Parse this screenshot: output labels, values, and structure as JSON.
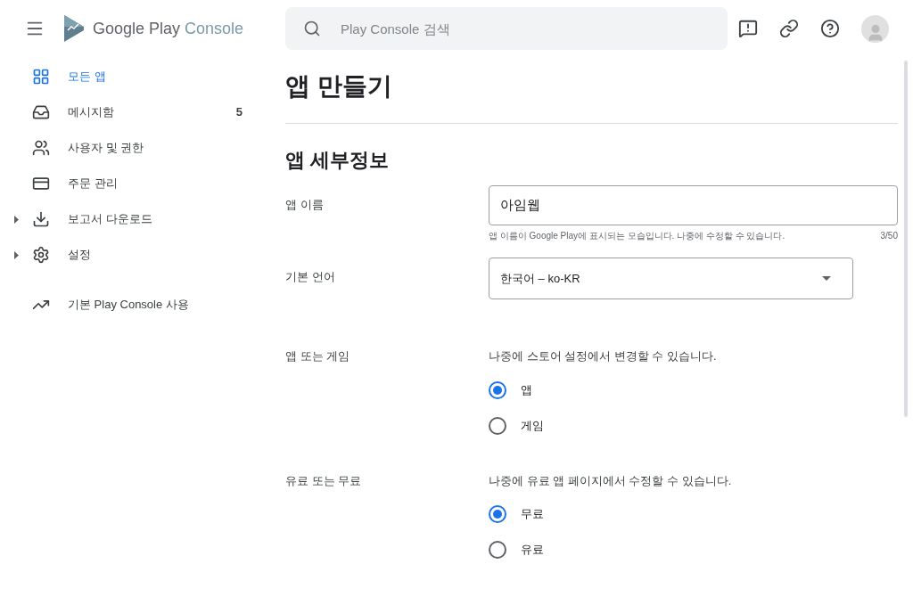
{
  "header": {
    "brand_main": "Google Play",
    "brand_sub": "Console",
    "search": {
      "placeholder": "Play Console 검색"
    }
  },
  "sidebar": {
    "items": [
      {
        "kind": "apps",
        "label": "모든 앱",
        "selected": true,
        "expandable": false
      },
      {
        "kind": "inbox",
        "label": "메시지함",
        "badge": "5",
        "selected": false,
        "expandable": false
      },
      {
        "kind": "users",
        "label": "사용자 및 권한",
        "selected": false,
        "expandable": false
      },
      {
        "kind": "card",
        "label": "주문 관리",
        "selected": false,
        "expandable": false
      },
      {
        "kind": "download",
        "label": "보고서 다운로드",
        "selected": false,
        "expandable": true
      },
      {
        "kind": "settings",
        "label": "설정",
        "selected": false,
        "expandable": true
      }
    ],
    "footer_item": {
      "kind": "trend",
      "label": "기본 Play Console 사용"
    }
  },
  "page": {
    "title": "앱 만들기",
    "section_title": "앱 세부정보",
    "app_name": {
      "label": "앱 이름",
      "value": "아임웹",
      "helper": "앱 이름이 Google Play에 표시되는 모습입니다. 나중에 수정할 수 있습니다.",
      "counter": "3/50"
    },
    "language": {
      "label": "기본 언어",
      "value": "한국어 – ko-KR"
    },
    "radio_groups": [
      {
        "label": "앱 또는 게임",
        "description": "나중에 스토어 설정에서 변경할 수 있습니다.",
        "options": [
          {
            "label": "앱",
            "selected": true
          },
          {
            "label": "게임",
            "selected": false
          }
        ]
      },
      {
        "label": "유료 또는 무료",
        "description": "나중에 유료 앱 페이지에서 수정할 수 있습니다.",
        "options": [
          {
            "label": "무료",
            "selected": true
          },
          {
            "label": "유료",
            "selected": false
          }
        ]
      }
    ]
  }
}
